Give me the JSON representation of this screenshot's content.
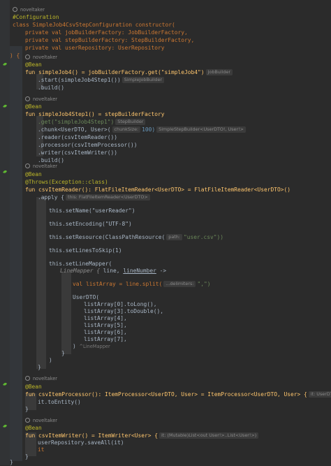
{
  "lines": {
    "l1": "#Configuration",
    "l2a": "class SimpleJob4CsvStepConfiguration constructor(",
    "l3": "private val jobBuilderFactory: JobBuilderFactory,",
    "l4": "private val stepBuilderFactory: StepBuilderFactory,",
    "l5": "private val userRepository: UserRepository",
    "l6": ") {",
    "ann_bean": "@Bean",
    "f1": "fun simpleJob4() = jobBuilderFactory.get(\"simpleJob4\")",
    "f1_hint": "JobBuilder",
    "f1a": ".start(simpleJob4Step1())",
    "f1a_hint": "SimpleJobBuilder",
    "f1b": ".build()",
    "f2": "fun simpleJob4Step1() = stepBuilderFactory",
    "f2a": ".get(\"simpleJob4Step1\")",
    "f2a_hint": "StepBuilder",
    "f2b": ".chunk<UserDTO, User>(",
    "f2b_param": "chunkSize:",
    "f2b_val": "100)",
    "f2b_hint": "SimpleStepBuilder<UserDTO!, User!>",
    "f2c": ".reader(csvItemReader())",
    "f2d": ".processor(csvItemProcessor())",
    "f2e": ".writer(csvItemWriter())",
    "f2f": ".build()",
    "throws": "@Throws(Exception::class)",
    "f3": "fun csvItemReader(): FlatFileItemReader<UserDTO> = FlatFileItemReader<UserDTO>()",
    "f3a": ".apply {",
    "f3a_hint": "this: FlatFileItemReader<UserDTO>",
    "r1": "this.setName(\"userReader\")",
    "r2": "this.setEncoding(\"UTF-8\")",
    "r3a": "this.setResource(ClassPathResource(",
    "r3_param": "path:",
    "r3b": "\"user.csv\"))",
    "r4": "this.setLinesToSkip(1)",
    "r5": "this.setLineMapper(",
    "r6a": "LineMapper {",
    "r6b": "line,",
    "r6c": "lineNumber",
    "r6d": "->",
    "r7a": "val listArray = line.split(",
    "r7_param": "...delimiters:",
    "r7b": "\",\")",
    "r8": "UserDTO(",
    "r9": "listArray[0].toLong(),",
    "r10": "listArray[3].toDouble(),",
    "r11": "listArray[4],",
    "r12": "listArray[5],",
    "r13": "listArray[6],",
    "r14": "listArray[7],",
    "r15a": ")",
    "r15_hint": "^LineMapper",
    "r16": "}",
    "r17": ")",
    "r18": "}",
    "f4": "fun csvItemProcessor(): ItemProcessor<UserDTO, User> = ItemProcessor<UserDTO, User> {",
    "f4_hint": "it: UserDTO",
    "f4a": "it.toEntity()",
    "f4b": "}",
    "f5": "fun csvItemWriter() = ItemWriter<User> {",
    "f5_hint": "it: (Mutable)List<out User!>..List<User!>)",
    "f5a": "userRepository.saveAll(it)",
    "f5b": "it",
    "f5c": "}",
    "end": "}"
  },
  "author": "noveltaker",
  "colors": {
    "background": "#2b2b2b",
    "keyword": "#cc7832",
    "function": "#ffc66d",
    "string": "#6a8759",
    "number": "#6897bb",
    "annotation": "#bbb529",
    "text": "#a9b7c6",
    "gutter_icon": "#5fb832"
  },
  "icons": [
    "bean-gutter-icon",
    "author-avatar-icon"
  ]
}
